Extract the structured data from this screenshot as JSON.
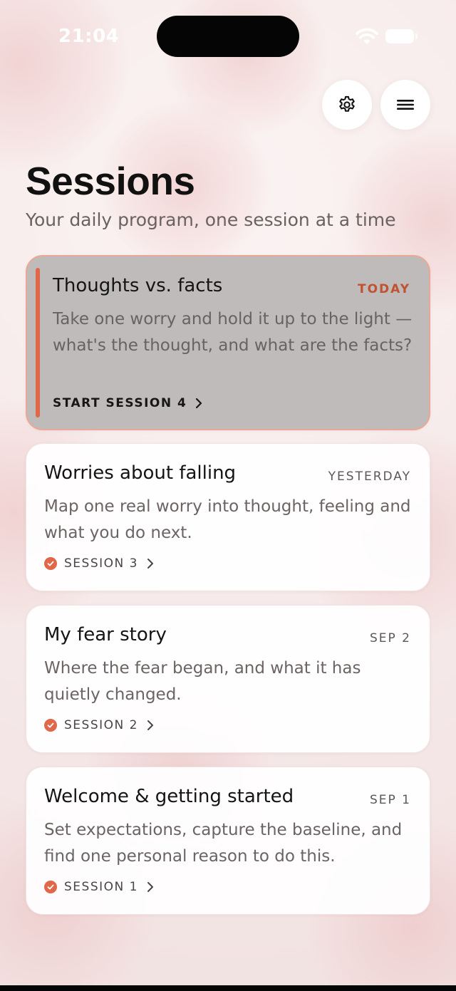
{
  "status_bar": {
    "time": "21:04"
  },
  "header": {
    "settings_icon": "gear-icon",
    "menu_icon": "hamburger-menu-icon",
    "title": "Sessions",
    "subtitle": "Your daily program, one session at a time"
  },
  "sessions": [
    {
      "title": "Thoughts vs. facts",
      "date": "TODAY",
      "description": "Take one worry and hold it up to the light — what's the thought, and what are the facts?",
      "link": "START SESSION 4",
      "state": "current"
    },
    {
      "title": "Worries about falling",
      "date": "YESTERDAY",
      "description": "Map one real worry into thought, feeling and what you do next.",
      "link": "SESSION 3",
      "state": "completed"
    },
    {
      "title": "My fear story",
      "date": "SEP 2",
      "description": "Where the fear began, and what it has quietly changed.",
      "link": "SESSION 2",
      "state": "completed"
    },
    {
      "title": "Welcome & getting started",
      "date": "SEP 1",
      "description": "Set expectations, capture the baseline, and find one personal reason to do this.",
      "link": "SESSION 1",
      "state": "completed"
    }
  ],
  "colors": {
    "accent": "#e0674a",
    "today_label": "#c0522f",
    "background": "#f7eeee",
    "active_card": "#bfbbbb"
  }
}
